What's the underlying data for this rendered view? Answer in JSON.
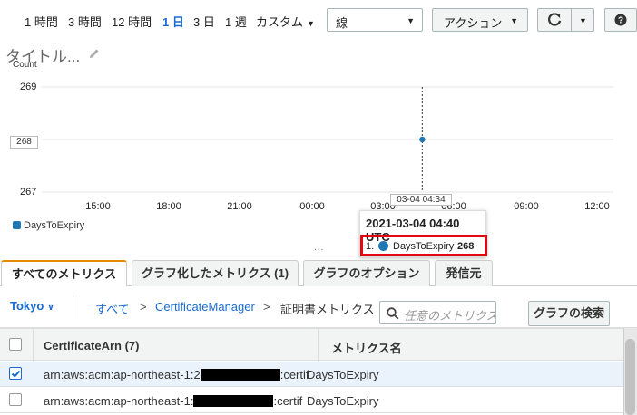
{
  "toolbar": {
    "ranges": [
      {
        "label": "1 時間",
        "active": false
      },
      {
        "label": "3 時間",
        "active": false
      },
      {
        "label": "12 時間",
        "active": false
      },
      {
        "label": "1 日",
        "active": true
      },
      {
        "label": "3 日",
        "active": false
      },
      {
        "label": "1 週",
        "active": false
      }
    ],
    "custom_label": "カスタム",
    "graph_type_value": "線",
    "actions_label": "アクション",
    "refresh_icon": "refresh-icon",
    "help_icon": "question-icon"
  },
  "graph": {
    "title": "タイトル...",
    "edit_icon": "pencil-icon",
    "hover_y_label": "268",
    "hover_x_label": "03-04 04:34",
    "legend_label": "DaysToExpiry",
    "resize_handle": "...",
    "tooltip": {
      "time": "2021-03-04 04:40 UTC",
      "index": "1.",
      "metric": "DaysToExpiry",
      "value": "268"
    }
  },
  "chart_data": {
    "type": "line",
    "ylabel": "Count",
    "ylim": [
      267,
      269
    ],
    "yticks": [
      "269",
      "267"
    ],
    "xticks": [
      "15:00",
      "18:00",
      "21:00",
      "00:00",
      "03:00",
      "06:00",
      "09:00",
      "12:00"
    ],
    "series": [
      {
        "name": "DaysToExpiry",
        "color": "#1f77b4",
        "points": [
          {
            "x": "03-04 04:40",
            "y": 268
          }
        ]
      }
    ]
  },
  "tabs": [
    {
      "label": "すべてのメトリクス",
      "active": true
    },
    {
      "label": "グラフ化したメトリクス (1)",
      "active": false
    },
    {
      "label": "グラフのオプション",
      "active": false
    },
    {
      "label": "発信元",
      "active": false
    }
  ],
  "browse": {
    "region": "Tokyo",
    "crumbs": {
      "all": "すべて",
      "sep": ">",
      "namespace": "CertificateManager",
      "current": "証明書メトリクス"
    },
    "search_placeholder": "任意のメトリクス",
    "search_button": "グラフの検索"
  },
  "table": {
    "headers": {
      "arn": "CertificateArn (7)",
      "metric": "メトリクス名"
    },
    "rows": [
      {
        "selected": true,
        "arn_prefix": "arn:aws:acm:ap-northeast-1:2",
        "arn_suffix": ":certif",
        "metric": "DaysToExpiry"
      },
      {
        "selected": false,
        "arn_prefix": "arn:aws:acm:ap-northeast-1:",
        "arn_suffix": ":certif",
        "metric": "DaysToExpiry"
      }
    ]
  },
  "colors": {
    "accent": "#1a6bd1",
    "series": "#1f77b4",
    "highlight": "#e30613",
    "active_tab": "#e68a00"
  }
}
